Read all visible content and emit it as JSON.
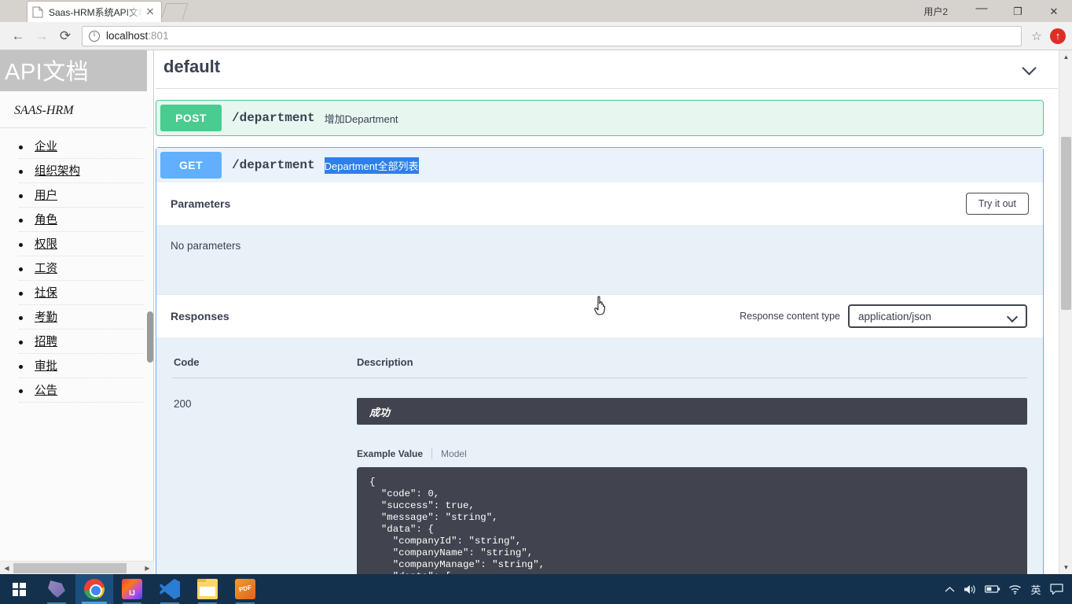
{
  "browser": {
    "tab": {
      "title": "Saas-HRM系统API文档",
      "favicon": "page-icon",
      "close": "×"
    },
    "new_tab_label": "",
    "profile_name": "用户2",
    "window_controls": {
      "minimize": "—",
      "maximize": "❐",
      "close": "✕"
    },
    "nav": {
      "back": "←",
      "forward": "→",
      "reload": "⟳"
    },
    "omnibox": {
      "security_icon": "info-icon",
      "host": "localhost",
      "port": ":801",
      "bookmark": "☆"
    },
    "extension": {
      "name": "extension-icon"
    }
  },
  "sidebar": {
    "header_title": "API文档",
    "subtitle": "SAAS-HRM",
    "items": [
      {
        "label": "企业"
      },
      {
        "label": "组织架构"
      },
      {
        "label": "用户"
      },
      {
        "label": "角色"
      },
      {
        "label": "权限"
      },
      {
        "label": "工资"
      },
      {
        "label": "社保"
      },
      {
        "label": "考勤"
      },
      {
        "label": "招聘"
      },
      {
        "label": "审批"
      },
      {
        "label": "公告"
      }
    ]
  },
  "swagger": {
    "tag": "default",
    "collapse_icon": "chevron-down-icon",
    "operations": [
      {
        "method": "POST",
        "path": "/department",
        "description": "增加Department",
        "expanded": false
      },
      {
        "method": "GET",
        "path": "/department",
        "description": "Department全部列表",
        "expanded": true,
        "description_selected": true
      }
    ],
    "parameters": {
      "title": "Parameters",
      "try_it_out_label": "Try it out",
      "empty_text": "No parameters"
    },
    "responses": {
      "title": "Responses",
      "content_type_label": "Response content type",
      "content_type_value": "application/json",
      "columns": {
        "code": "Code",
        "description": "Description"
      },
      "rows": [
        {
          "code": "200",
          "description": "成功",
          "example_tab_active": "Example Value",
          "example_tab_other": "Model",
          "example_value": "{\n  \"code\": 0,\n  \"success\": true,\n  \"message\": \"string\",\n  \"data\": {\n    \"companyId\": \"string\",\n    \"companyName\": \"string\",\n    \"companyManage\": \"string\",\n    \"depts\": ["
        }
      ]
    }
  },
  "taskbar": {
    "start": "windows-logo",
    "apps": [
      {
        "name": "navicat",
        "state": "open"
      },
      {
        "name": "chrome",
        "state": "active"
      },
      {
        "name": "intellij-idea",
        "state": "open"
      },
      {
        "name": "vscode",
        "state": "open"
      },
      {
        "name": "file-explorer",
        "state": "open"
      },
      {
        "name": "foxit-pdf",
        "state": "open"
      }
    ],
    "tray": [
      {
        "name": "show-hidden-icons",
        "glyph": "⌃"
      },
      {
        "name": "volume",
        "glyph": "🔊"
      },
      {
        "name": "battery",
        "glyph": "🔋"
      },
      {
        "name": "wifi",
        "glyph": "📶"
      },
      {
        "name": "ime-language",
        "glyph": "英"
      },
      {
        "name": "notifications",
        "glyph": "🗨"
      }
    ]
  },
  "colors": {
    "post": "#49cc90",
    "get": "#61affe",
    "selection": "#2f7fe8",
    "dark_panel": "#41444e",
    "taskbar": "#13314d"
  }
}
